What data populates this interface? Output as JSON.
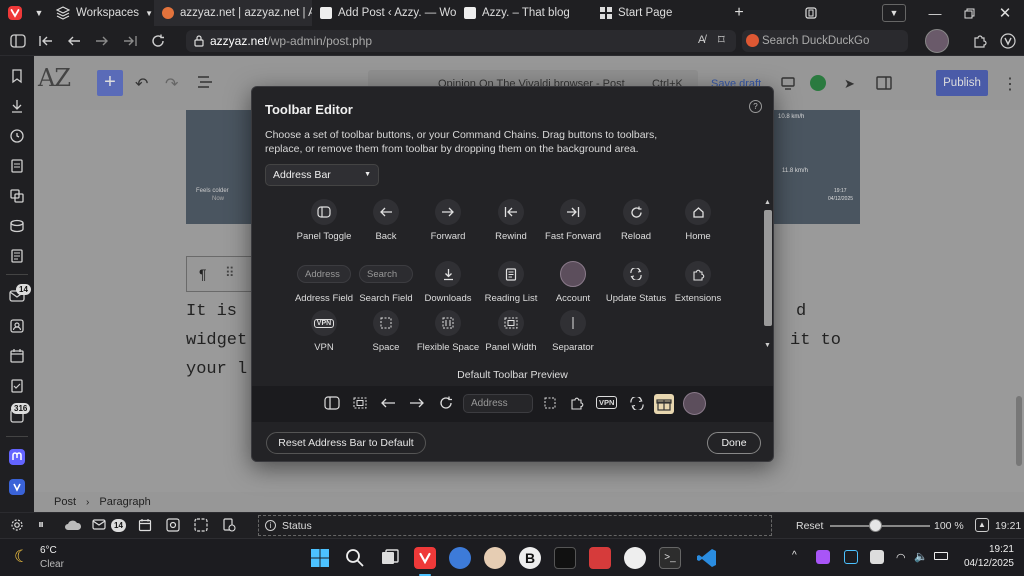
{
  "browser": {
    "workspaces_label": "Workspaces",
    "tabs": [
      {
        "label": "azzyaz.net | azzyaz.net | Az"
      },
      {
        "label": "Add Post ‹ Azzy. — WordPr"
      },
      {
        "label": "Azzy. – That blog"
      },
      {
        "label": "Start Page"
      }
    ],
    "url_host": "azzyaz.net",
    "url_path": "/wp-admin/post.php",
    "search_placeholder": "Search DuckDuckGo",
    "badges": {
      "mail": "14",
      "feeds": "316"
    }
  },
  "wp": {
    "logo": "AZ",
    "doc_title": "Opinion On The Vivaldi browser - Post",
    "shortcut": "Ctrl+K",
    "save_draft": "Save draft",
    "publish": "Publish",
    "body_line1_start": "It is",
    "body_line1_end": "d",
    "body_line2_start": "widget",
    "body_line2_end": "it to",
    "body_line3_start": "your l",
    "breadcrumb": [
      "Post",
      "Paragraph"
    ],
    "screenshot": {
      "feels_colder": "Feels colder",
      "now": "Now",
      "speed1": "10.8 km/h",
      "speed2": "11.8 km/h",
      "time": "19:17",
      "date": "04/12/2025"
    }
  },
  "toolbar_editor": {
    "title": "Toolbar Editor",
    "help": "?",
    "description": "Choose a set of toolbar buttons, or your Command Chains. Drag buttons to toolbars, replace, or remove them from toolbar by dropping them on the background area.",
    "selected_toolbar": "Address Bar",
    "items": [
      {
        "label": "Panel Toggle",
        "icon": "panel-toggle-icon"
      },
      {
        "label": "Back",
        "icon": "back-arrow-icon"
      },
      {
        "label": "Forward",
        "icon": "forward-arrow-icon"
      },
      {
        "label": "Rewind",
        "icon": "rewind-icon"
      },
      {
        "label": "Fast Forward",
        "icon": "fast-forward-icon"
      },
      {
        "label": "Reload",
        "icon": "reload-icon"
      },
      {
        "label": "Home",
        "icon": "home-icon"
      },
      {
        "label": "Address Field",
        "placeholder": "Address"
      },
      {
        "label": "Search Field",
        "placeholder": "Search"
      },
      {
        "label": "Downloads",
        "icon": "downloads-icon"
      },
      {
        "label": "Reading List",
        "icon": "reading-list-icon"
      },
      {
        "label": "Account",
        "icon": "account-avatar-icon"
      },
      {
        "label": "Update Status",
        "icon": "update-status-icon"
      },
      {
        "label": "Extensions",
        "icon": "extensions-icon"
      },
      {
        "label": "VPN",
        "icon": "vpn-icon",
        "badge": "VPN"
      },
      {
        "label": "Space",
        "icon": "space-icon"
      },
      {
        "label": "Flexible Space",
        "icon": "flexible-space-icon"
      },
      {
        "label": "Panel Width",
        "icon": "panel-width-icon"
      },
      {
        "label": "Separator",
        "icon": "separator-icon"
      }
    ],
    "preview_title": "Default Toolbar Preview",
    "preview_address": "Address",
    "preview_vpn": "VPN",
    "reset_button": "Reset Address Bar to Default",
    "done_button": "Done"
  },
  "statusbar": {
    "mail_count": "14",
    "status_text": "Status",
    "reset": "Reset",
    "zoom": "100 %",
    "zoom_level": 0.45,
    "clock": "19:21"
  },
  "taskbar": {
    "weather_temp": "6°C",
    "weather_desc": "Clear",
    "time": "19:21",
    "date": "04/12/2025"
  },
  "colors": {
    "accent_blue": "#3858e9",
    "modal_bg": "#232326",
    "page_dim": "#9a9a9a",
    "vpn_green": "#2ab24f"
  }
}
